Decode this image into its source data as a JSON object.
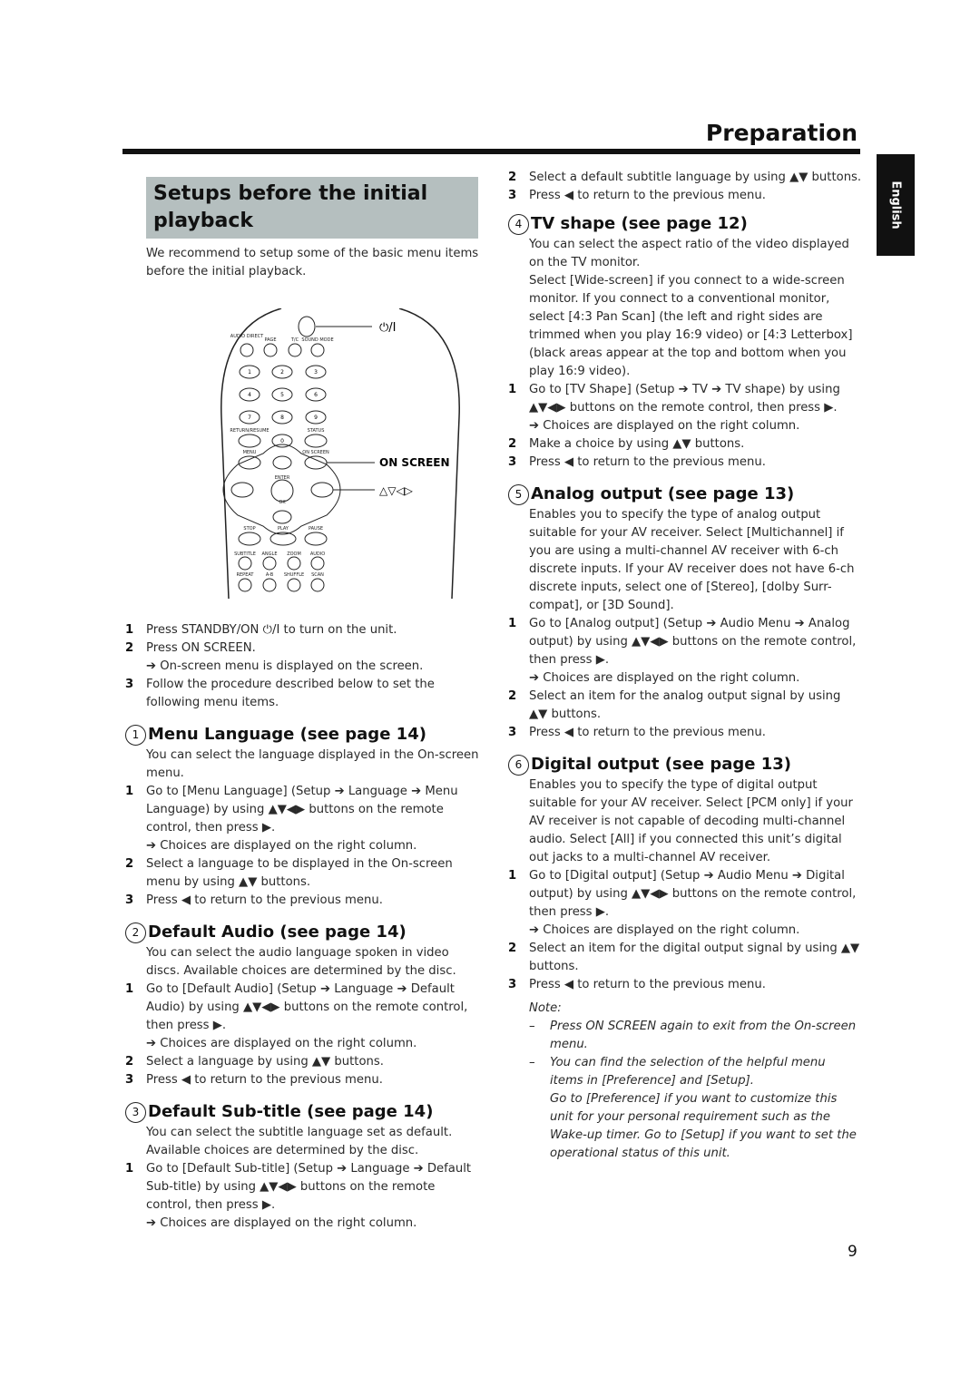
{
  "header": {
    "section_title": "Preparation",
    "language_tab": "English"
  },
  "title": "Setups before the initial playback",
  "intro": "We recommend to setup some of the basic menu items before the initial playback.",
  "remote": {
    "callouts": {
      "power": "⏻/I",
      "on_screen": "ON SCREEN",
      "arrows": "△▽◁▷"
    },
    "labels": {
      "audio_direct": "AUDIO DIRECT",
      "page": "PAGE",
      "tc": "T/C",
      "sound_mode": "SOUND MODE",
      "return_resume": "RETURN/RESUME",
      "status": "STATUS",
      "menu": "MENU",
      "on_screen": "ON SCREEN",
      "enter": "ENTER",
      "ok": "OK",
      "stop": "STOP",
      "play": "PLAY",
      "pause": "PAUSE",
      "subtitle": "SUBTITLE",
      "angle": "ANGLE",
      "zoom": "ZOOM",
      "audio": "AUDIO",
      "repeat": "REPEAT",
      "ab": "A-B",
      "shuffle": "SHUFFLE",
      "scan": "SCAN"
    },
    "digits": [
      "1",
      "2",
      "3",
      "4",
      "5",
      "6",
      "7",
      "8",
      "9",
      "0"
    ]
  },
  "intro_steps": [
    {
      "n": "1",
      "text": "Press STANDBY/ON ⏻/I to turn on the unit."
    },
    {
      "n": "2",
      "text": "Press ON SCREEN.",
      "result": "➔ On-screen menu is displayed on the screen."
    },
    {
      "n": "3",
      "text": "Follow the procedure described below to set the following menu items."
    }
  ],
  "sections": [
    {
      "num": "1",
      "title": "Menu Language (see page 14)",
      "desc": "You can select the language displayed in the On-screen menu.",
      "steps": [
        {
          "n": "1",
          "text": "Go to [Menu Language] (Setup ➔ Language ➔ Menu Language) by using ▲▼◀▶ buttons on the remote control, then press ▶.",
          "result": "➔ Choices are displayed on the right column."
        },
        {
          "n": "2",
          "text": "Select a language to be displayed in the On-screen menu by using ▲▼ buttons."
        },
        {
          "n": "3",
          "text": "Press ◀ to return to the previous menu."
        }
      ]
    },
    {
      "num": "2",
      "title": "Default Audio (see page 14)",
      "desc": "You can select the audio language spoken in video discs. Available choices are determined by the disc.",
      "steps": [
        {
          "n": "1",
          "text": "Go to [Default Audio] (Setup ➔ Language ➔ Default Audio) by using ▲▼◀▶ buttons on the remote control, then press ▶.",
          "result": "➔ Choices are displayed on the right column."
        },
        {
          "n": "2",
          "text": "Select a language by using ▲▼ buttons."
        },
        {
          "n": "3",
          "text": "Press ◀ to return to the previous menu."
        }
      ]
    },
    {
      "num": "3",
      "title": "Default Sub-title (see page 14)",
      "desc": "You can select the subtitle language set as default. Available choices are determined by the disc.",
      "steps": [
        {
          "n": "1",
          "text": "Go to [Default Sub-title] (Setup ➔ Language ➔ Default Sub-title) by using ▲▼◀▶ buttons on the remote control, then press ▶.",
          "result": "➔ Choices are displayed on the right column."
        },
        {
          "n": "2",
          "text": "Select a default subtitle language by using ▲▼ buttons."
        },
        {
          "n": "3",
          "text": "Press ◀ to return to the previous menu."
        }
      ]
    },
    {
      "num": "4",
      "title": "TV shape (see page 12)",
      "desc": "You can select the aspect ratio of the video displayed on the TV monitor.",
      "desc2": "Select [Wide-screen] if you connect to a wide-screen monitor. If you connect to a conventional monitor, select [4:3 Pan Scan] (the left and right sides are trimmed when you play 16:9 video) or [4:3 Letterbox] (black areas appear at the top and bottom when you play 16:9 video).",
      "steps": [
        {
          "n": "1",
          "text": "Go to [TV Shape] (Setup ➔ TV ➔ TV shape) by using ▲▼◀▶ buttons on the remote control, then press ▶.",
          "result": "➔ Choices are displayed on the right column."
        },
        {
          "n": "2",
          "text": "Make a choice by using ▲▼ buttons."
        },
        {
          "n": "3",
          "text": "Press ◀ to return to the previous menu."
        }
      ]
    },
    {
      "num": "5",
      "title": "Analog output (see page 13)",
      "desc": "Enables you to specify the type of analog output suitable for your AV receiver. Select [Multichannel] if you are using a multi-channel AV receiver with 6-ch discrete inputs. If your AV receiver does not have 6-ch discrete inputs, select one of [Stereo], [dolby Surr-compat], or [3D Sound].",
      "steps": [
        {
          "n": "1",
          "text": "Go to [Analog output] (Setup ➔ Audio Menu ➔ Analog output) by using ▲▼◀▶ buttons on the remote control, then press ▶.",
          "result": "➔ Choices are displayed on the right column."
        },
        {
          "n": "2",
          "text": "Select an item for the analog output signal by using ▲▼ buttons."
        },
        {
          "n": "3",
          "text": "Press ◀ to return to the previous menu."
        }
      ]
    },
    {
      "num": "6",
      "title": "Digital output (see page 13)",
      "desc": "Enables you to specify the type of digital output suitable for your AV receiver. Select [PCM only] if your AV receiver is not capable of decoding multi-channel audio. Select [All] if you connected this unit’s digital out jacks to a multi-channel AV receiver.",
      "steps": [
        {
          "n": "1",
          "text": "Go to [Digital output] (Setup ➔ Audio Menu ➔ Digital output) by using ▲▼◀▶ buttons on the remote control, then press ▶.",
          "result": "➔ Choices are displayed on the right column."
        },
        {
          "n": "2",
          "text": "Select an item for the digital output signal by using ▲▼ buttons."
        },
        {
          "n": "3",
          "text": "Press ◀ to return to the previous menu."
        }
      ]
    }
  ],
  "note": {
    "label": "Note:",
    "items": [
      {
        "dash": "–",
        "text": "Press ON SCREEN again to exit from the On-screen menu."
      },
      {
        "dash": "–",
        "text": "You can find the selection of the helpful menu items in [Preference] and [Setup]."
      }
    ],
    "extra": "Go to [Preference] if you want to customize this unit for your personal requirement such as the Wake-up timer. Go to [Setup] if you want to set the operational status of this unit."
  },
  "page_number": "9",
  "circled": [
    "①",
    "②",
    "③",
    "④",
    "⑤",
    "⑥"
  ]
}
